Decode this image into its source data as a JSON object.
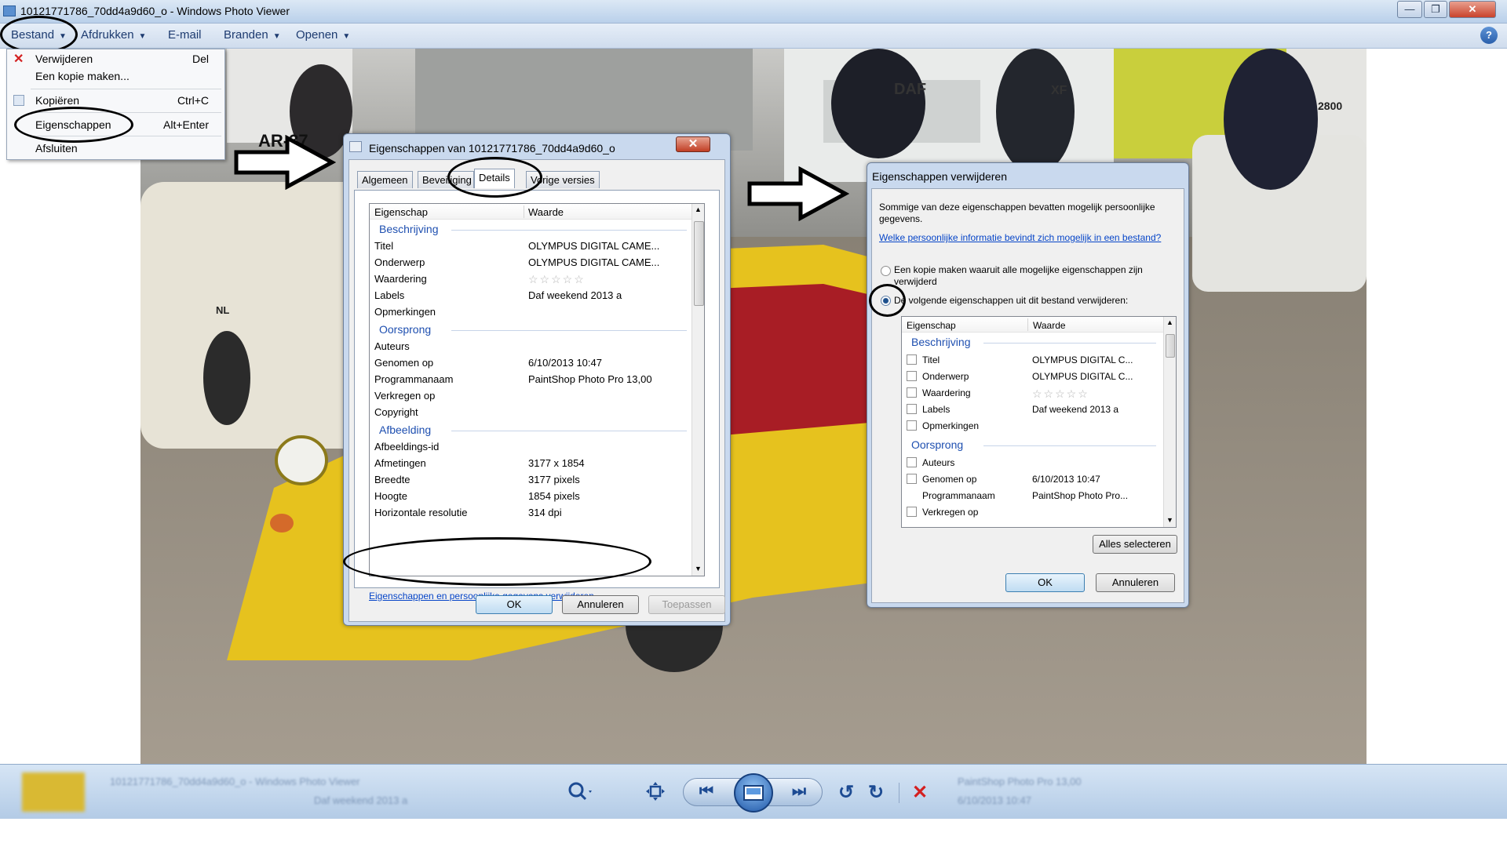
{
  "window": {
    "title": "10121771786_70dd4a9d60_o - Windows Photo Viewer",
    "minimize": "—",
    "maximize": "❐",
    "close": "✕"
  },
  "menubar": {
    "items": [
      "Bestand",
      "Afdrukken",
      "E-mail",
      "Branden",
      "Openen"
    ],
    "help": "?"
  },
  "file_menu": {
    "items": [
      {
        "label": "Verwijderen",
        "key": "Del"
      },
      {
        "label": "Een kopie maken...",
        "key": ""
      },
      {
        "label": "Kopiëren",
        "key": "Ctrl+C"
      },
      {
        "label": "Eigenschappen",
        "key": "Alt+Enter"
      },
      {
        "label": "Afsluiten",
        "key": ""
      }
    ]
  },
  "props_dialog": {
    "title": "Eigenschappen van 10121771786_70dd4a9d60_o",
    "close": "✕",
    "tabs": [
      "Algemeen",
      "Beveiliging",
      "Details",
      "Vorige versies"
    ],
    "col_property": "Eigenschap",
    "col_value": "Waarde",
    "sections": [
      {
        "name": "Beschrijving",
        "rows": [
          {
            "k": "Titel",
            "v": "OLYMPUS DIGITAL CAME..."
          },
          {
            "k": "Onderwerp",
            "v": "OLYMPUS DIGITAL CAME..."
          },
          {
            "k": "Waardering",
            "v": "☆☆☆☆☆"
          },
          {
            "k": "Labels",
            "v": "Daf weekend 2013 a"
          },
          {
            "k": "Opmerkingen",
            "v": ""
          }
        ]
      },
      {
        "name": "Oorsprong",
        "rows": [
          {
            "k": "Auteurs",
            "v": ""
          },
          {
            "k": "Genomen op",
            "v": "6/10/2013 10:47"
          },
          {
            "k": "Programmanaam",
            "v": "PaintShop Photo Pro 13,00"
          },
          {
            "k": "Verkregen op",
            "v": ""
          },
          {
            "k": "Copyright",
            "v": ""
          }
        ]
      },
      {
        "name": "Afbeelding",
        "rows": [
          {
            "k": "Afbeeldings-id",
            "v": ""
          },
          {
            "k": "Afmetingen",
            "v": "3177 x 1854"
          },
          {
            "k": "Breedte",
            "v": "3177 pixels"
          },
          {
            "k": "Hoogte",
            "v": "1854 pixels"
          },
          {
            "k": "Horizontale resolutie",
            "v": "314 dpi"
          }
        ]
      }
    ],
    "remove_link": "Eigenschappen en persoonlijke gegevens verwijderen",
    "ok": "OK",
    "cancel": "Annuleren",
    "apply": "Toepassen"
  },
  "remove_dialog": {
    "title": "Eigenschappen verwijderen",
    "intro": "Sommige van deze eigenschappen bevatten mogelijk persoonlijke gegevens.",
    "link": "Welke persoonlijke informatie bevindt zich mogelijk in een bestand?",
    "option_copy": "Een kopie maken waaruit alle mogelijke eigenschappen zijn verwijderd",
    "option_remove": "De volgende eigenschappen uit dit bestand verwijderen:",
    "col_property": "Eigenschap",
    "col_value": "Waarde",
    "sections": [
      {
        "name": "Beschrijving",
        "rows": [
          {
            "k": "Titel",
            "v": "OLYMPUS DIGITAL C...",
            "checkbox": true
          },
          {
            "k": "Onderwerp",
            "v": "OLYMPUS DIGITAL C...",
            "checkbox": true
          },
          {
            "k": "Waardering",
            "v": "☆☆☆☆☆",
            "checkbox": true
          },
          {
            "k": "Labels",
            "v": "Daf weekend 2013 a",
            "checkbox": true
          },
          {
            "k": "Opmerkingen",
            "v": "",
            "checkbox": true
          }
        ]
      },
      {
        "name": "Oorsprong",
        "rows": [
          {
            "k": "Auteurs",
            "v": "",
            "checkbox": true
          },
          {
            "k": "Genomen op",
            "v": "6/10/2013 10:47",
            "checkbox": true
          },
          {
            "k": "Programmanaam",
            "v": "PaintShop Photo Pro...",
            "checkbox": false
          },
          {
            "k": "Verkregen op",
            "v": "",
            "checkbox": true
          }
        ]
      }
    ],
    "select_all": "Alles selecteren",
    "ok": "OK",
    "cancel": "Annuleren"
  },
  "photo_text": {
    "truck_brand": "DAF",
    "truck_model": "XF",
    "plate": "AR-37",
    "country": "NL",
    "truck_number": "2800"
  },
  "colors": {
    "car_yellow": "#e6c21e",
    "accent_blue": "#2a5fab"
  }
}
